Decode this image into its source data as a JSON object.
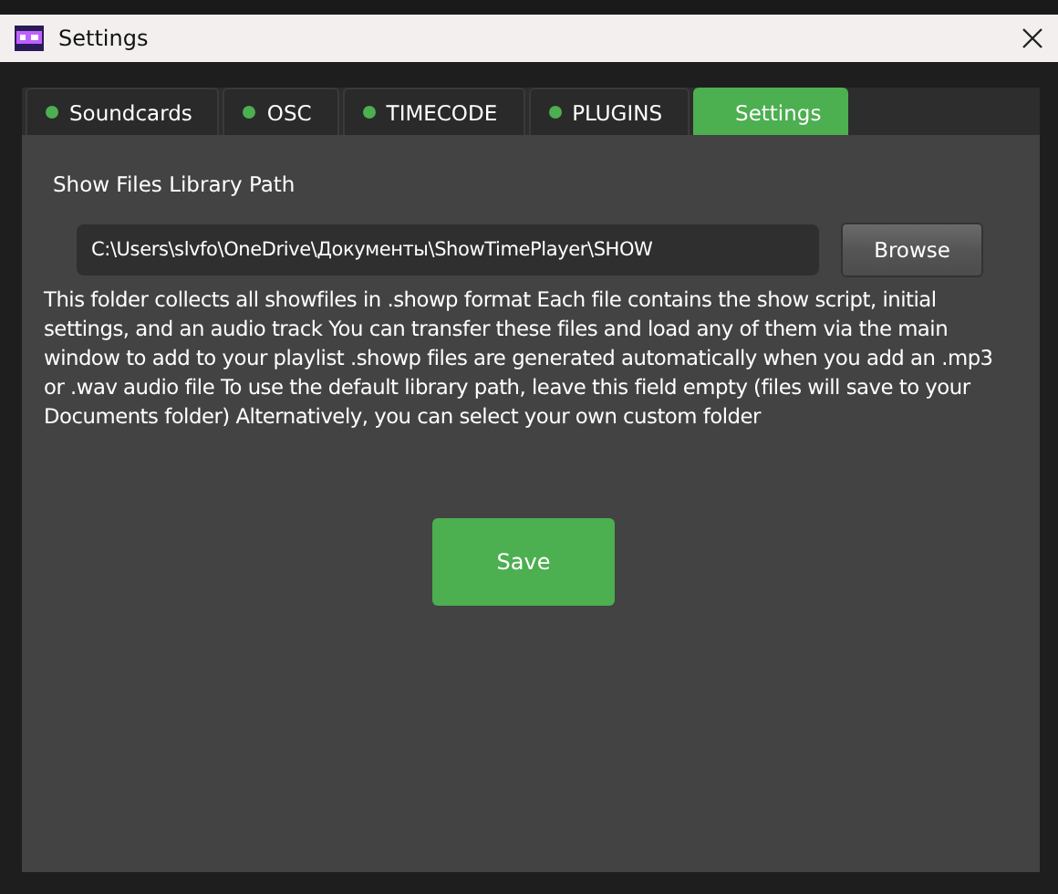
{
  "window": {
    "title": "Settings"
  },
  "tabs": [
    {
      "label": "Soundcards",
      "selected": false
    },
    {
      "label": "OSC",
      "selected": false
    },
    {
      "label": "TIMECODE",
      "selected": false
    },
    {
      "label": "PLUGINS",
      "selected": false
    },
    {
      "label": "Settings",
      "selected": true
    }
  ],
  "library": {
    "label": "Show Files Library Path",
    "path": "C:\\Users\\slvfo\\OneDrive\\Документы\\ShowTimePlayer\\SHOW",
    "browse": "Browse",
    "description": "This folder collects all showfiles in .showp format Each file contains the show script, initial settings, and an audio track You can transfer these files and load any of them via the main window to add to your playlist .showp files are generated automatically when you add an .mp3 or .wav audio file To use the default library path, leave this field empty (files will save to your Documents folder) Alternatively, you can select your own custom folder"
  },
  "save": "Save"
}
